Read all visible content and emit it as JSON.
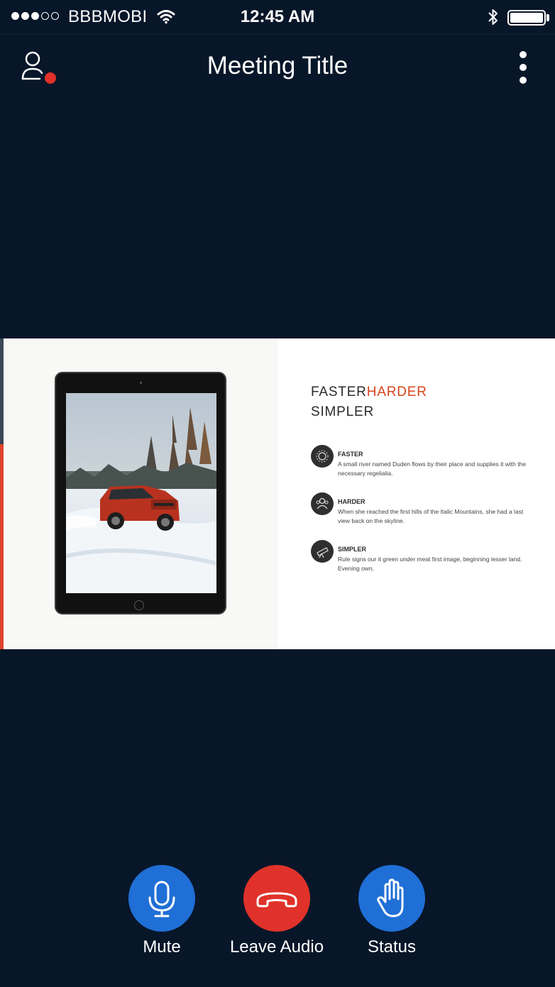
{
  "status_bar": {
    "carrier": "BBBMOBI",
    "time": "12:45 AM",
    "signal_bars_filled": 3,
    "signal_bars_total": 5
  },
  "nav": {
    "title": "Meeting Title",
    "user_icon": "user-icon",
    "presence_dot_color": "#e0322a",
    "more_icon": "more-vertical-icon"
  },
  "slide": {
    "heading_part1": "FASTER",
    "heading_part2": "HARDER",
    "heading_line2": "SIMPLER",
    "accent_color": "#d9431e",
    "features": [
      {
        "title": "FASTER",
        "text": "A small river named Duden flows by their place and supplies it with the necessary regelialia.",
        "icon": "gear-icon"
      },
      {
        "title": "HARDER",
        "text": "When she reached the first hills of the Italic Mountains, she had a last view back on the skyline.",
        "icon": "people-icon"
      },
      {
        "title": "SIMPLER",
        "text": "Rule signs our it green under meat first image, beginning lesser land. Evening own.",
        "icon": "telescope-icon"
      }
    ]
  },
  "controls": {
    "mute_label": "Mute",
    "leave_label": "Leave Audio",
    "status_label": "Status",
    "primary_color": "#1f6fd6",
    "danger_color": "#e0322a"
  }
}
